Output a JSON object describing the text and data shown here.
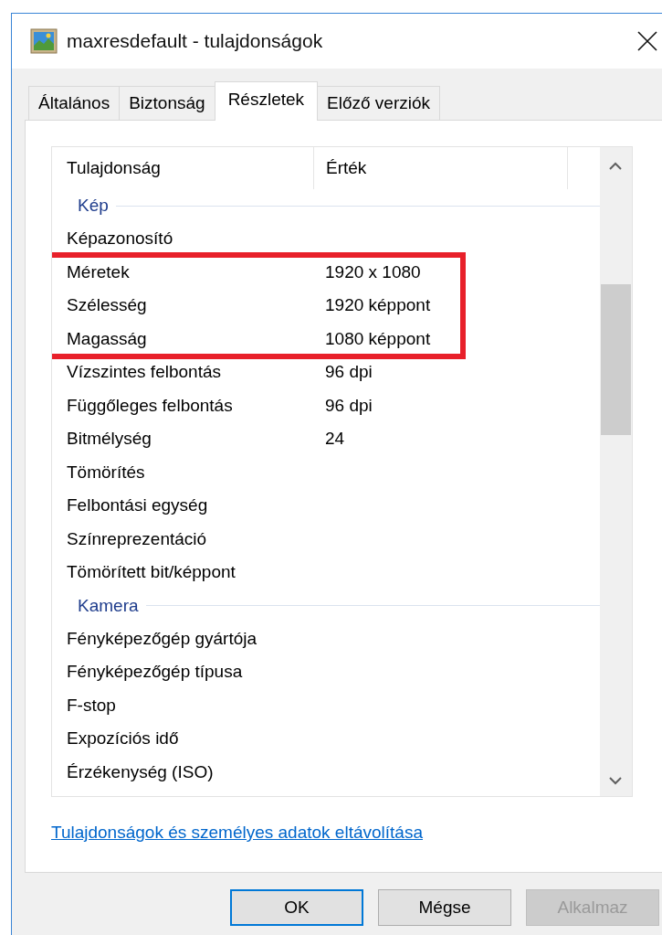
{
  "window": {
    "title": "maxresdefault - tulajdonságok"
  },
  "tabs": [
    {
      "label": "Általános",
      "selected": false
    },
    {
      "label": "Biztonság",
      "selected": false
    },
    {
      "label": "Részletek",
      "selected": true
    },
    {
      "label": "Előző verziók",
      "selected": false
    }
  ],
  "table": {
    "columns": [
      "Tulajdonság",
      "Érték"
    ],
    "sections": [
      {
        "title": "Kép",
        "rows": [
          {
            "name": "Képazonosító",
            "highlighted": false
          },
          {
            "name": "Méretek",
            "value": "1920 x 1080",
            "highlighted": true
          },
          {
            "name": "Szélesség",
            "value": "1920 képpont",
            "highlighted": true
          },
          {
            "name": "Magasság",
            "value": "1080 képpont",
            "highlighted": true
          },
          {
            "name": "Vízszintes felbontás",
            "value": "96 dpi",
            "highlighted": false
          },
          {
            "name": "Függőleges felbontás",
            "value": "96 dpi",
            "highlighted": false
          },
          {
            "name": "Bitmélység",
            "value": "24",
            "highlighted": false
          },
          {
            "name": "Tömörítés",
            "highlighted": false
          },
          {
            "name": "Felbontási egység",
            "highlighted": false
          },
          {
            "name": "Színreprezentáció",
            "highlighted": false
          },
          {
            "name": "Tömörített bit/képpont",
            "highlighted": false
          }
        ]
      },
      {
        "title": "Kamera",
        "rows": [
          {
            "name": "Fényképezőgép gyártója",
            "highlighted": false
          },
          {
            "name": "Fényképezőgép típusa",
            "highlighted": false
          },
          {
            "name": "F-stop",
            "highlighted": false
          },
          {
            "name": "Expozíciós idő",
            "highlighted": false
          },
          {
            "name": "Érzékenység (ISO)",
            "highlighted": false
          }
        ]
      }
    ]
  },
  "link": "Tulajdonságok és személyes adatok eltávolítása",
  "buttons": [
    {
      "label": "OK",
      "kind": "default",
      "disabled": false
    },
    {
      "label": "Mégse",
      "kind": "normal",
      "disabled": false
    },
    {
      "label": "Alkalmaz",
      "kind": "normal",
      "disabled": true
    }
  ]
}
